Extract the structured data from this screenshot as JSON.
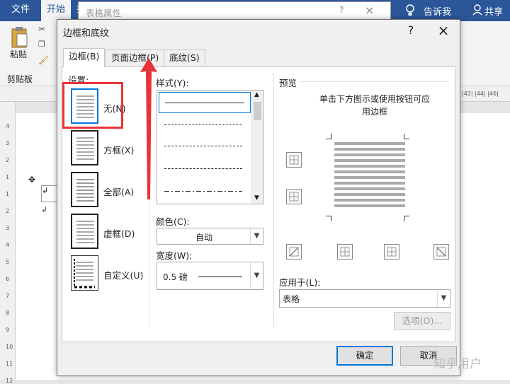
{
  "ribbon": {
    "tabs": [
      "文件",
      "开始",
      "插"
    ],
    "tell_me": "告诉我",
    "share": "共享",
    "paste_label": "粘贴",
    "clipboard_label": "剪贴板"
  },
  "background_dialog": {
    "title": "表格属性",
    "help": "?",
    "close": "×"
  },
  "dialog": {
    "title": "边框和底纹",
    "help": "?",
    "close": "×",
    "tabs": [
      "边框(B)",
      "页面边框(P)",
      "底纹(S)"
    ],
    "settings_label": "设置:",
    "settings": [
      "无(N)",
      "方框(X)",
      "全部(A)",
      "虚框(D)",
      "自定义(U)"
    ],
    "style_label": "样式(Y):",
    "color_label": "颜色(C):",
    "color_value": "自动",
    "width_label": "宽度(W):",
    "width_value": "0.5 磅",
    "preview_label": "预览",
    "preview_hint_1": "单击下方图示或使用按钮可应",
    "preview_hint_2": "用边框",
    "apply_label": "应用于(L):",
    "apply_value": "表格",
    "options_button": "选项(O)...",
    "ok_button": "确定",
    "cancel_button": "取消"
  },
  "watermark": "知乎用户",
  "colors": {
    "ribbon": "#2b579a",
    "accent": "#0078d7",
    "highlight": "#e8333a"
  },
  "ruler_left_numbers": [
    "4",
    "3",
    "2",
    "1",
    "1",
    "2",
    "3",
    "4",
    "5",
    "6",
    "7",
    "8",
    "9",
    "10",
    "11",
    "12"
  ]
}
